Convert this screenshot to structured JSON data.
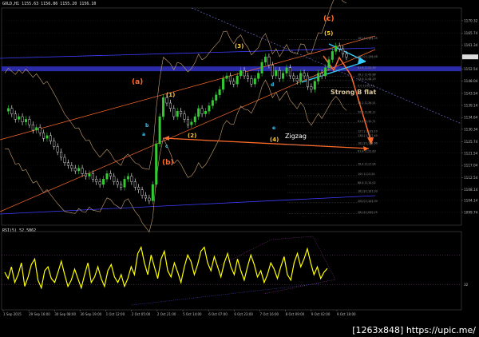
{
  "header": {
    "title": "GOLD,H1  1155.63 1156.86 1155.20 1156.10"
  },
  "indicator": {
    "label": "RSI(5) 52.5862",
    "level_label": "32"
  },
  "footer": {
    "credit": "[1263x848] https://upic.me/"
  },
  "colors": {
    "background": "#000000",
    "bull": "#33cc33",
    "rsi": "#ffff00",
    "bands": "#c8a070",
    "orange": "#ff6a2a",
    "blue_band": "#3232c8",
    "cyan": "#33ccff",
    "wave_red": "#ff3a3a",
    "wave_yellow": "#ffcc33",
    "wave_cyan": "#33ccff",
    "wave_magenta": "#ff33cc",
    "wave_white": "#ffffff"
  },
  "chart_data": {
    "type": "line",
    "price_axis": {
      "min": 1095,
      "max": 1175,
      "ticks": [
        "1170.32",
        "1165.74",
        "1161.34",
        "1157.04",
        "1152.54",
        "1148.04",
        "1143.54",
        "1139.14",
        "1134.64",
        "1130.34",
        "1125.74",
        "1121.54",
        "1117.04",
        "1112.54",
        "1108.14",
        "1104.14",
        "1099.74"
      ]
    },
    "time_axis": {
      "labels": [
        "1 Sep 2015",
        "29 Sep 16:00",
        "30 Sep 08:00",
        "30 Sep 19:00",
        "1 Oct 12:00",
        "2 Oct 05:00",
        "2 Oct 21:00",
        "5 Oct 14:00",
        "6 Oct 07:00",
        "6 Oct 23:00",
        "7 Oct 16:00",
        "8 Oct 09:00",
        "9 Oct 02:00",
        "9 Oct 18:00"
      ]
    },
    "price_series": [
      1137,
      1138,
      1136,
      1134,
      1135,
      1133,
      1134,
      1132,
      1130,
      1131,
      1129,
      1127,
      1128,
      1126,
      1124,
      1122,
      1120,
      1118,
      1117,
      1116,
      1115,
      1116,
      1114,
      1113,
      1114,
      1112,
      1111,
      1110,
      1112,
      1114,
      1113,
      1111,
      1110,
      1109,
      1112,
      1113,
      1111,
      1109,
      1108,
      1106,
      1105,
      1104,
      1110,
      1125,
      1135,
      1142,
      1140,
      1138,
      1135,
      1137,
      1136,
      1134,
      1132,
      1133,
      1135,
      1138,
      1136,
      1137,
      1139,
      1141,
      1143,
      1145,
      1149,
      1150,
      1148,
      1147,
      1150,
      1152,
      1150,
      1149,
      1147,
      1149,
      1151,
      1155,
      1157,
      1154,
      1150,
      1152,
      1149,
      1151,
      1153,
      1150,
      1149,
      1148,
      1151,
      1150,
      1146,
      1145,
      1148,
      1151,
      1150,
      1153,
      1156,
      1159,
      1161,
      1160,
      1158,
      1157
    ],
    "rsi_series": [
      48,
      40,
      55,
      35,
      45,
      60,
      30,
      42,
      58,
      65,
      38,
      28,
      50,
      55,
      40,
      35,
      48,
      62,
      45,
      30,
      38,
      52,
      40,
      28,
      45,
      60,
      35,
      42,
      55,
      40,
      30,
      50,
      58,
      42,
      35,
      45,
      30,
      40,
      55,
      45,
      72,
      80,
      60,
      45,
      70,
      55,
      40,
      65,
      75,
      50,
      42,
      60,
      48,
      35,
      55,
      70,
      62,
      45,
      58,
      75,
      80,
      60,
      50,
      68,
      55,
      42,
      60,
      72,
      55,
      45,
      65,
      50,
      38,
      55,
      70,
      58,
      42,
      50,
      35,
      45,
      60,
      52,
      40,
      55,
      68,
      45,
      38,
      60,
      72,
      55,
      65,
      78,
      60,
      45,
      55,
      40,
      48,
      53
    ],
    "rsi_levels": [
      70,
      32
    ],
    "annotations": {
      "wave_labels": [
        "(a)",
        "(b)",
        "(c)",
        "(1)",
        "(2)",
        "(3)",
        "(4)",
        "(5)",
        "a",
        "b",
        "c",
        "d",
        "e"
      ],
      "text_labels": [
        "Zigzag",
        "Strong B flat"
      ],
      "fib_levels": [
        {
          "label": "161.8 1163.35"
        },
        {
          "label": "100.0 1156.48"
        },
        {
          "label": "61.8 1152.39"
        },
        {
          "label": "38.2 1149.88"
        },
        {
          "label": "23.6 1148.29"
        },
        {
          "label": "0.0 1145.74"
        },
        {
          "label": "38.2 1139.51"
        },
        {
          "label": "50.0 1136.11"
        },
        {
          "label": "61.8 1132.71"
        },
        {
          "label": "127.2 1129.10"
        },
        {
          "label": "138.2 1127.40"
        },
        {
          "label": "161.8 1124.66"
        },
        {
          "label": "61.8 1121.63"
        },
        {
          "label": "76.4 1117.04"
        },
        {
          "label": "100 1113.24"
        },
        {
          "label": "88.6 1110.02"
        },
        {
          "label": "161.8 1107.03"
        },
        {
          "label": "200.0 1103.30"
        },
        {
          "label": "261.8 1099.25"
        }
      ]
    }
  }
}
